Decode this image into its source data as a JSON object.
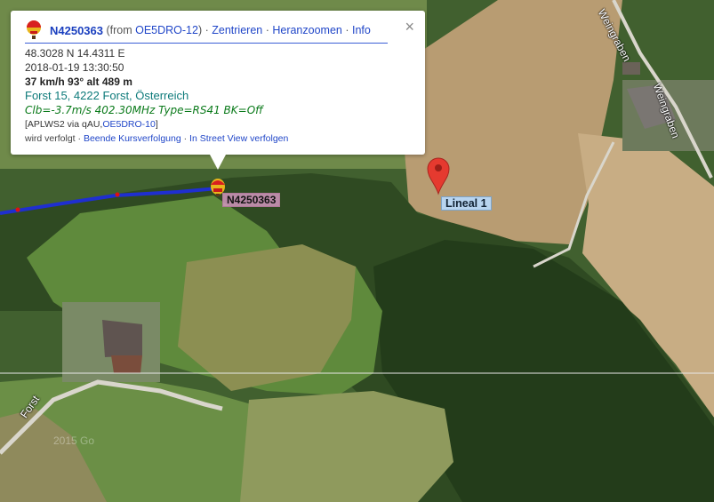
{
  "info": {
    "callsign": "N4250363",
    "from_prefix": " (from ",
    "from_station": "OE5DRO-12",
    "from_suffix": ")",
    "sep1": " · ",
    "action_center": "Zentrieren",
    "sep2": " · ",
    "action_zoom": "Heranzoomen",
    "sep3": " · ",
    "action_info": "Info",
    "close": "×",
    "coords": "48.3028 N 14.4311 E",
    "timestamp": "2018-01-19 13:30:50",
    "speed": "37 km/h 93° alt 489 m",
    "address": "Forst 15, 4222 Forst, Österreich",
    "telemetry": "Clb=-3.7m/s 402.30MHz Type=RS41 BK=Off",
    "path_prefix": "[APLWS2 via qAU,",
    "path_station": "OE5DRO-10",
    "path_suffix": "]",
    "track_status": "wird verfolgt",
    "track_sep1": " · ",
    "track_stop": "Beende Kursverfolgung",
    "track_sep2": " · ",
    "track_streetview": "In Street View verfolgen"
  },
  "map": {
    "station_label": "N4250363",
    "ruler_label": "Lineal 1",
    "road_forst": "Forst",
    "road_weingraben_top": "Weingraben",
    "road_weingraben": "Weingraben",
    "watermark": "2015 Go",
    "track_color": "#1f2fd0",
    "marker_color": "#e53a2f"
  }
}
